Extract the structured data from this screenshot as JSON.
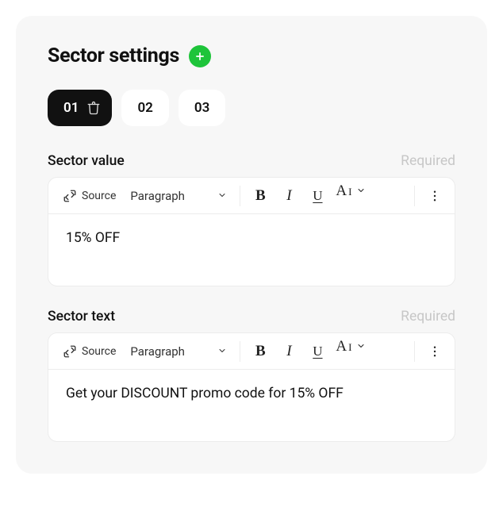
{
  "header": {
    "title": "Sector settings"
  },
  "tabs": [
    {
      "label": "01",
      "active": true
    },
    {
      "label": "02",
      "active": false
    },
    {
      "label": "03",
      "active": false
    }
  ],
  "toolbar": {
    "source_label": "Source",
    "paragraph_label": "Paragraph"
  },
  "fields": {
    "value": {
      "label": "Sector value",
      "required_text": "Required",
      "content": "15% OFF"
    },
    "text": {
      "label": "Sector text",
      "required_text": "Required",
      "content": "Get your DISCOUNT promo code for 15% OFF"
    }
  }
}
